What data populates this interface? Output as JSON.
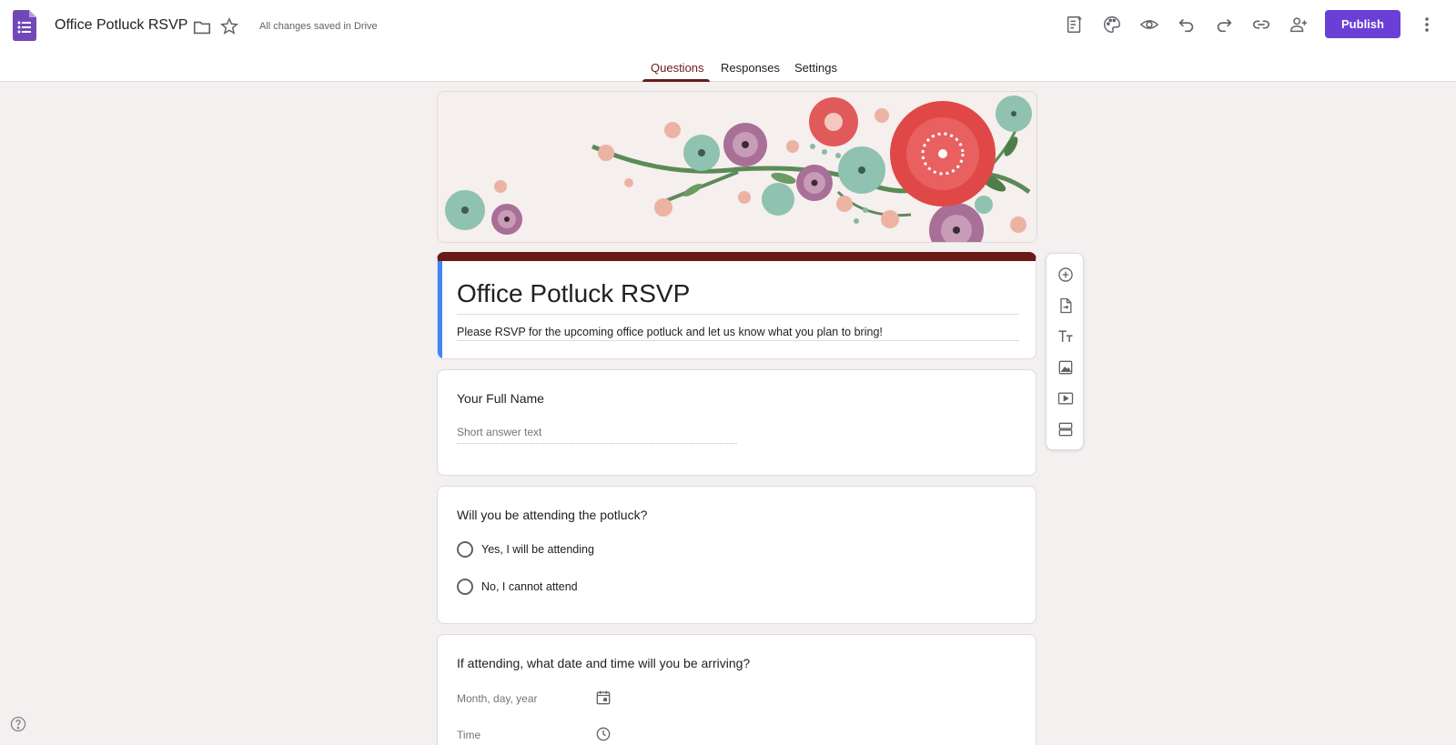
{
  "app": {
    "doc_title": "Office Potluck RSVP",
    "save_status": "All changes saved in Drive",
    "publish_label": "Publish",
    "accent_color": "#6b3fd6",
    "theme_color": "#6b1a1a"
  },
  "toolbar_icons": [
    "addon-icon",
    "palette-icon",
    "preview-eye-icon",
    "undo-icon",
    "redo-icon",
    "link-icon",
    "add-collaborator-icon",
    "more-vert-icon"
  ],
  "tabs": [
    {
      "label": "Questions",
      "active": true
    },
    {
      "label": "Responses",
      "active": false
    },
    {
      "label": "Settings",
      "active": false
    }
  ],
  "form": {
    "title": "Office Potluck RSVP",
    "description": "Please RSVP for the upcoming office potluck and let us know what you plan to bring!"
  },
  "questions": [
    {
      "title": "Your Full Name",
      "type": "short_answer",
      "placeholder": "Short answer text"
    },
    {
      "title": "Will you be attending the potluck?",
      "type": "multiple_choice",
      "options": [
        "Yes, I will be attending",
        "No, I cannot attend"
      ]
    },
    {
      "title": "If attending, what date and time will you be arriving?",
      "type": "date_time",
      "date_placeholder": "Month, day, year",
      "time_placeholder": "Time"
    }
  ],
  "side_toolbar": [
    "add-question-icon",
    "import-questions-icon",
    "add-title-icon",
    "add-image-icon",
    "add-video-icon",
    "add-section-icon"
  ]
}
